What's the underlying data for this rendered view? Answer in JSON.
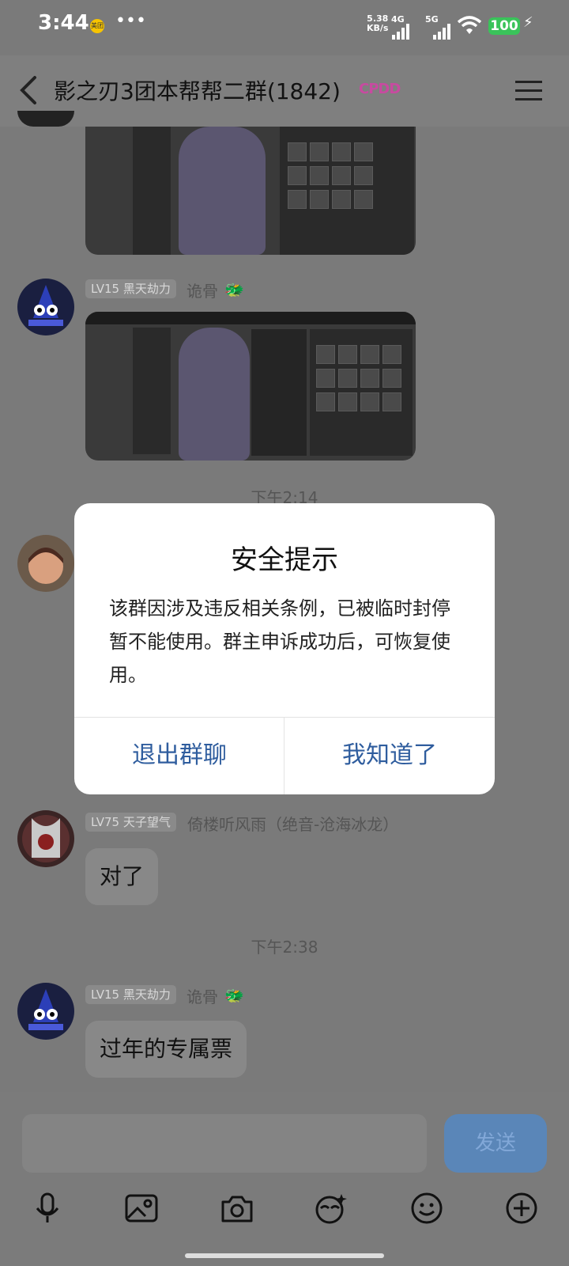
{
  "status": {
    "time": "3:44",
    "app_tag": "美团",
    "speed_value": "5.38",
    "speed_unit": "KB/s",
    "net1": "4G",
    "net2": "5G",
    "battery": "100"
  },
  "header": {
    "title": "影之刃3团本帮帮二群(1842)",
    "badge": "CPDD"
  },
  "messages": {
    "m1": {
      "level": "LV15 黑天劫力",
      "name": "诡骨"
    },
    "time1": "下午2:14",
    "m3": {
      "level": "LV75 天子望气",
      "name": "倚楼听风雨（绝音-沧海冰龙）",
      "text": "对了"
    },
    "time2": "下午2:38",
    "m4": {
      "level": "LV15 黑天劫力",
      "name": "诡骨",
      "text": "过年的专属票"
    }
  },
  "input": {
    "send_label": "发送"
  },
  "dialog": {
    "title": "安全提示",
    "body": "该群因涉及违反相关条例，已被临时封停暂不能使用。群主申诉成功后，可恢复使用。",
    "left_button": "退出群聊",
    "right_button": "我知道了"
  }
}
